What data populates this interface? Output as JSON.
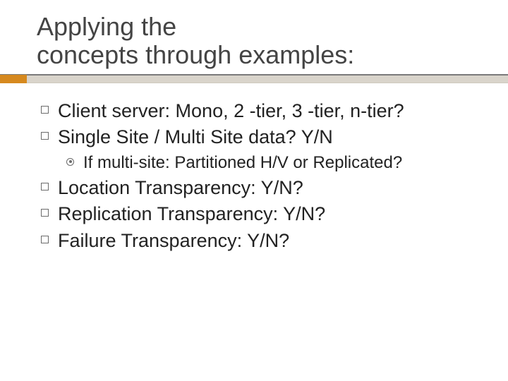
{
  "title_line1": "Applying the",
  "title_line2": "concepts through examples:",
  "bullets": {
    "b0": "Client server: Mono, 2 -tier, 3 -tier, n-tier?",
    "b1": "Single Site / Multi Site data? Y/N",
    "b1_sub0": "If multi-site: Partitioned H/V or Replicated?",
    "b2": "Location Transparency: Y/N?",
    "b3": "Replication Transparency: Y/N?",
    "b4": "Failure Transparency: Y/N?"
  }
}
